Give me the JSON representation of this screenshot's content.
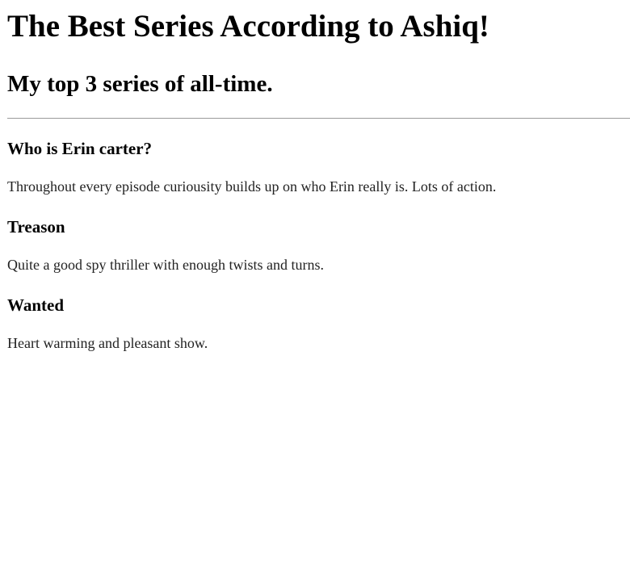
{
  "title": "The Best Series According to Ashiq!",
  "subtitle": "My top 3 series of all-time.",
  "series": [
    {
      "name": "Who is Erin carter?",
      "description": "Throughout every episode curiousity builds up on who Erin really is. Lots of action."
    },
    {
      "name": "Treason",
      "description": "Quite a good spy thriller with enough twists and turns."
    },
    {
      "name": "Wanted",
      "description": "Heart warming and pleasant show."
    }
  ]
}
